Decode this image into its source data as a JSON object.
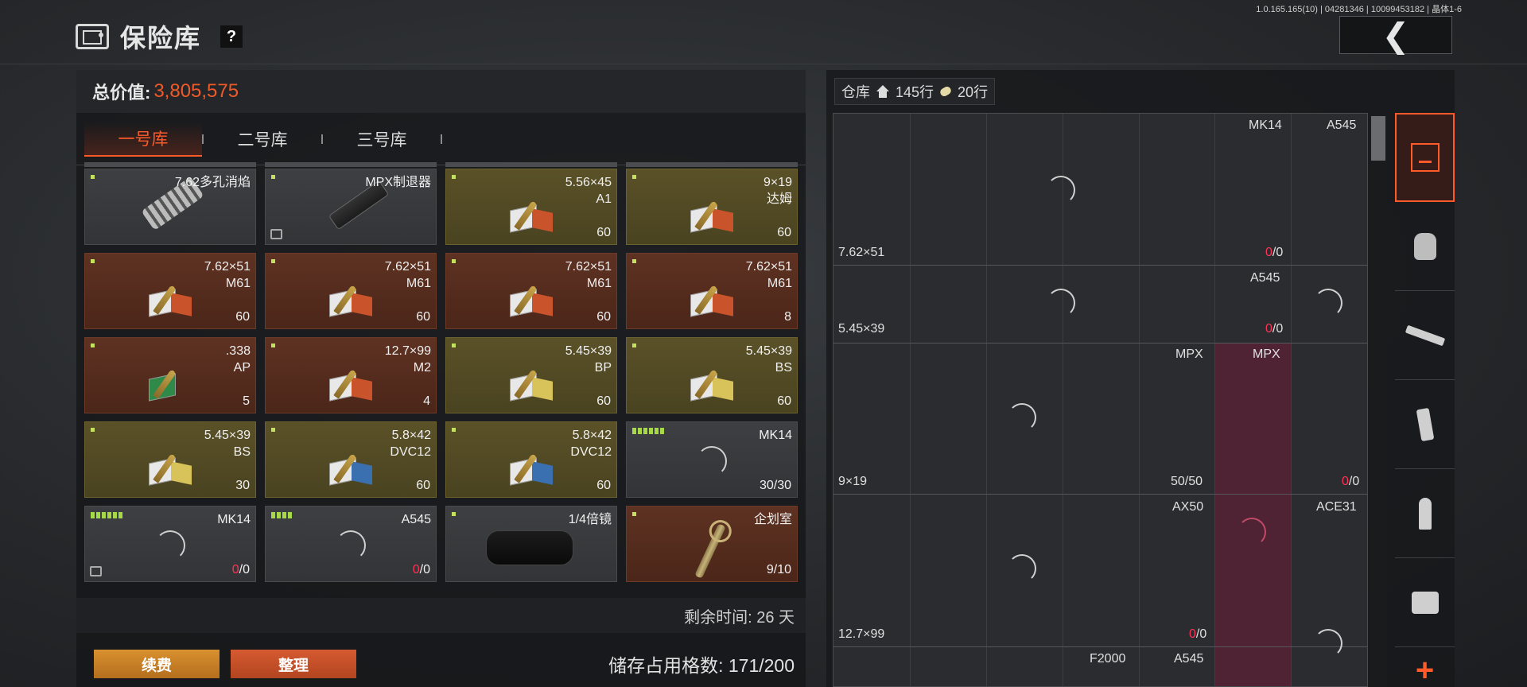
{
  "version": "1.0.165.165(10) | 04281346 | 10099453182 | 晶体1-6",
  "header": {
    "title": "保险库",
    "help": "?",
    "back_arrow": "chevron-left-icon"
  },
  "left": {
    "total_label": "总价值:",
    "total_value": "3,805,575",
    "tabs": [
      {
        "label": "一号库",
        "active": true
      },
      {
        "label": "二号库",
        "active": false
      },
      {
        "label": "三号库",
        "active": false
      }
    ],
    "items": [
      {
        "name": "7.62多孔消焰",
        "count": ""
      },
      {
        "name": "MPX制退器",
        "count": ""
      },
      {
        "name": "5.56×45\nA1",
        "count": "60"
      },
      {
        "name": "9×19\n达姆",
        "count": "60"
      },
      {
        "name": "7.62×51\nM61",
        "count": "60"
      },
      {
        "name": "7.62×51\nM61",
        "count": "60"
      },
      {
        "name": "7.62×51\nM61",
        "count": "60"
      },
      {
        "name": "7.62×51\nM61",
        "count": "8"
      },
      {
        "name": ".338\nAP",
        "count": "5"
      },
      {
        "name": "12.7×99\nM2",
        "count": "4"
      },
      {
        "name": "5.45×39\nBP",
        "count": "60"
      },
      {
        "name": "5.45×39\nBS",
        "count": "60"
      },
      {
        "name": "5.45×39\nBS",
        "count": "30"
      },
      {
        "name": "5.8×42\nDVC12",
        "count": "60"
      },
      {
        "name": "5.8×42\nDVC12",
        "count": "60"
      },
      {
        "name": "MK14",
        "count": "30/30"
      },
      {
        "name": "MK14",
        "count_zero": "0",
        "count_rest": "/0"
      },
      {
        "name": "A545",
        "count_zero": "0",
        "count_rest": "/0"
      },
      {
        "name": "1/4倍镜",
        "count": ""
      },
      {
        "name": "企划室",
        "count": "9/10"
      }
    ],
    "remaining_time": "剩余时间: 26 天",
    "renew_label": "续费",
    "sort_label": "整理",
    "storage_used": "储存占用格数: 171/200"
  },
  "right": {
    "warehouse_label": "仓库",
    "rows_home": "145行",
    "rows_ammo": "20行",
    "slots": {
      "r1_mk14": "MK14",
      "r1_a545": "A545",
      "r1_cal": "7.62×51",
      "r1_zero": "0",
      "r1_rest": "/0",
      "r2_a545": "A545",
      "r2_cal": "5.45×39",
      "r2_zero": "0",
      "r2_rest": "/0",
      "r3_mpx1": "MPX",
      "r3_mpx2": "MPX",
      "r3_cal": "9×19",
      "r3_count": "50/50",
      "r3_zero": "0",
      "r3_rest": "/0",
      "r4_ax50": "AX50",
      "r4_ace31": "ACE31",
      "r4_cal": "12.7×99",
      "r4_zero": "0",
      "r4_rest": "/0",
      "r5_f2000": "F2000",
      "r5_a545": "A545"
    },
    "side_tabs": [
      "storage-icon",
      "vest-icon",
      "rifle-icon",
      "magazine-icon",
      "ammo-icon",
      "sight-icon",
      "plus-icon"
    ],
    "plus": "+"
  },
  "colors": {
    "accent": "#ff5a2a",
    "total_value": "#f05a28",
    "zero": "#ff3355"
  }
}
